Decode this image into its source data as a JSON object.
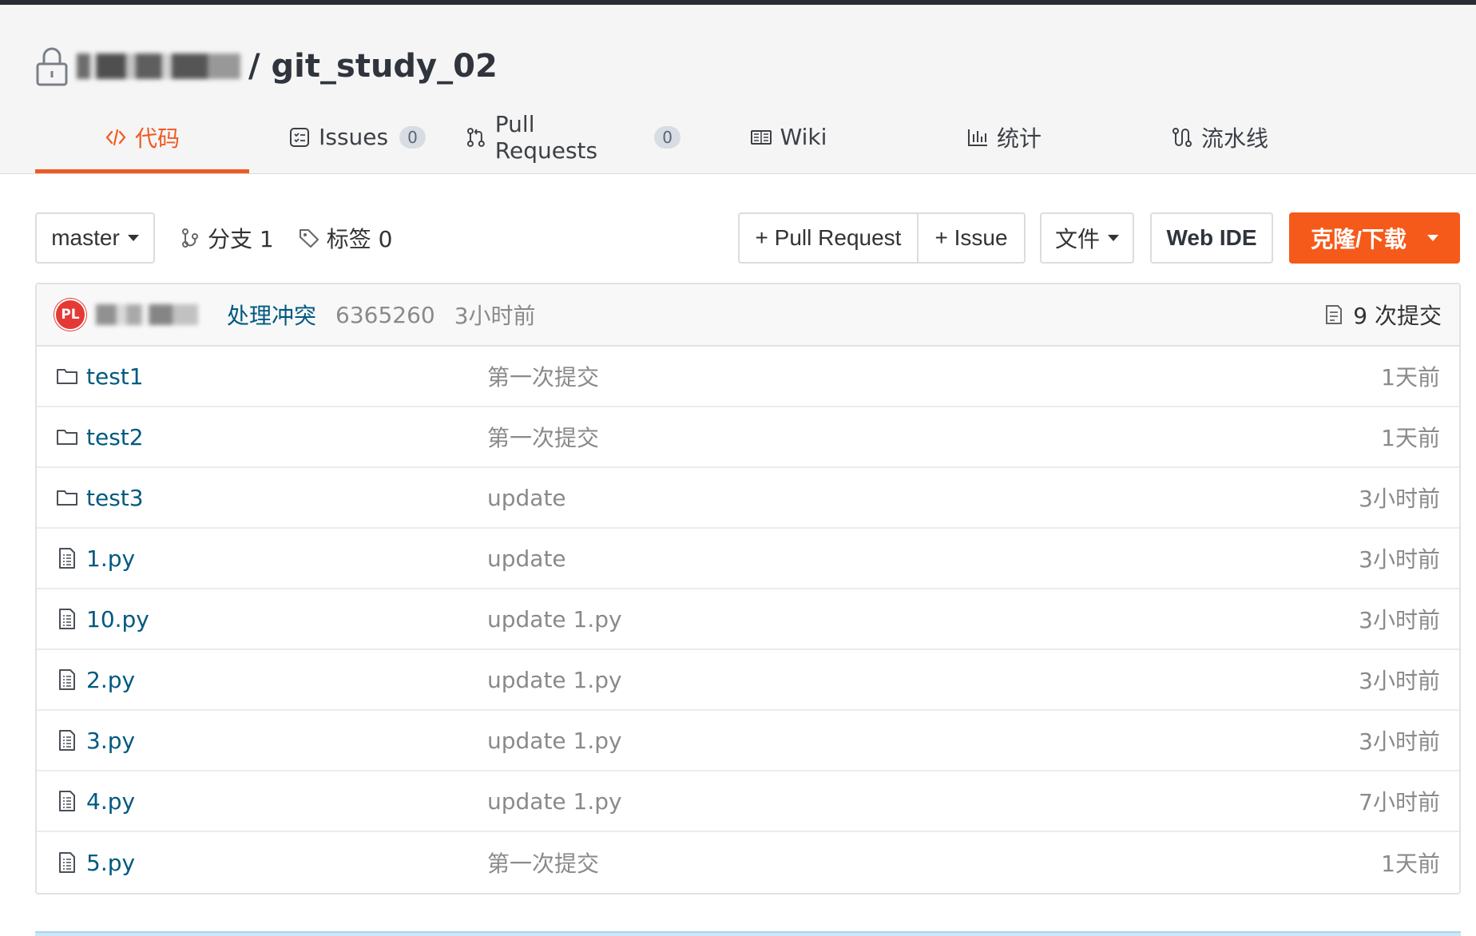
{
  "repo": {
    "owner_masked": "████",
    "separator": "/",
    "name": "git_study_02"
  },
  "tabs": [
    {
      "label": "代码",
      "icon": "code-icon",
      "active": true
    },
    {
      "label": "Issues",
      "icon": "issues-icon",
      "badge": "0"
    },
    {
      "label": "Pull Requests",
      "icon": "pull-request-icon",
      "badge": "0"
    },
    {
      "label": "Wiki",
      "icon": "wiki-icon"
    },
    {
      "label": "统计",
      "icon": "stats-icon"
    },
    {
      "label": "流水线",
      "icon": "pipeline-icon"
    }
  ],
  "toolbar": {
    "branch": "master",
    "branches_label": "分支 1",
    "tags_label": "标签 0",
    "pull_request_button": "+ Pull Request",
    "issue_button": "+ Issue",
    "files_button": "文件",
    "web_ide_button": "Web IDE",
    "clone_button": "克隆/下载"
  },
  "last_commit": {
    "avatar_initials": "PL",
    "message": "处理冲突",
    "hash": "6365260",
    "time": "3小时前",
    "commit_count": "9 次提交"
  },
  "files": [
    {
      "type": "folder",
      "name": "test1",
      "message": "第一次提交",
      "time": "1天前"
    },
    {
      "type": "folder",
      "name": "test2",
      "message": "第一次提交",
      "time": "1天前"
    },
    {
      "type": "folder",
      "name": "test3",
      "message": "update",
      "time": "3小时前"
    },
    {
      "type": "file",
      "name": "1.py",
      "message": "update",
      "time": "3小时前"
    },
    {
      "type": "file",
      "name": "10.py",
      "message": "update 1.py",
      "time": "3小时前"
    },
    {
      "type": "file",
      "name": "2.py",
      "message": "update 1.py",
      "time": "3小时前"
    },
    {
      "type": "file",
      "name": "3.py",
      "message": "update 1.py",
      "time": "3小时前"
    },
    {
      "type": "file",
      "name": "4.py",
      "message": "update 1.py",
      "time": "7小时前"
    },
    {
      "type": "file",
      "name": "5.py",
      "message": "第一次提交",
      "time": "1天前"
    }
  ],
  "colors": {
    "accent": "#f05a22",
    "link": "#005980",
    "muted": "#8a8a8a"
  }
}
